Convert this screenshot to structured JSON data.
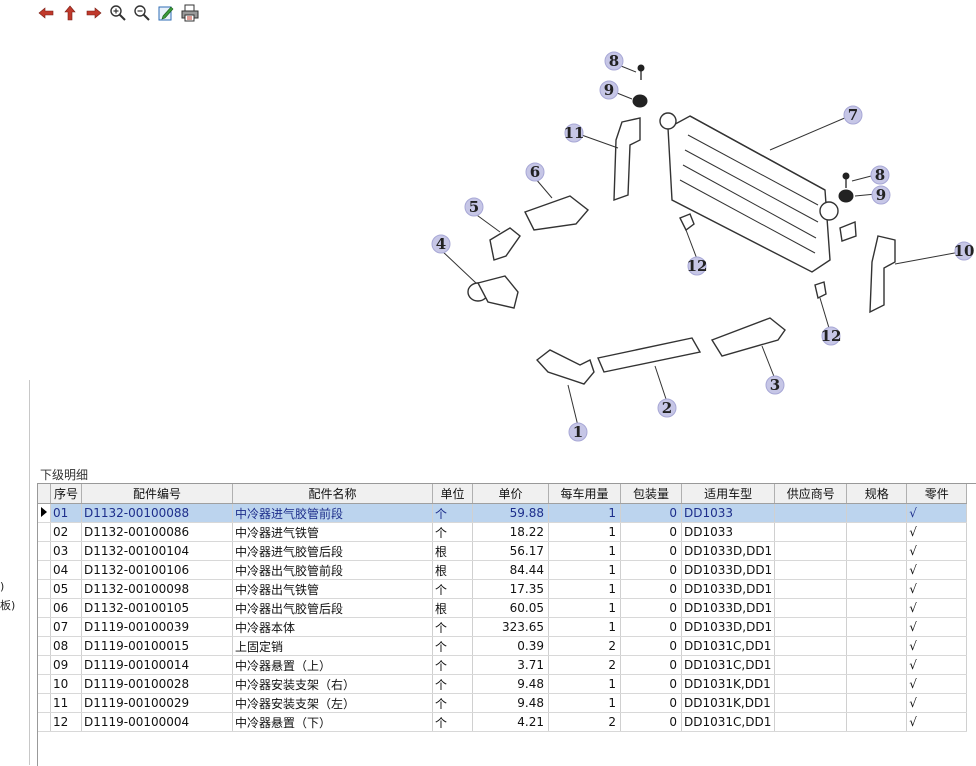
{
  "left_panel": {
    "text_1": ")",
    "text_2": "板)"
  },
  "toolbar": {
    "buttons": [
      {
        "icon": "back-arrow-icon"
      },
      {
        "icon": "up-arrow-icon"
      },
      {
        "icon": "forward-arrow-icon"
      },
      {
        "icon": "zoom-in-icon"
      },
      {
        "icon": "zoom-out-icon"
      },
      {
        "icon": "edit-icon"
      },
      {
        "icon": "print-icon"
      }
    ]
  },
  "diagram": {
    "callouts": [
      "1",
      "2",
      "3",
      "4",
      "5",
      "6",
      "7",
      "8",
      "8",
      "9",
      "9",
      "10",
      "11",
      "12",
      "12"
    ]
  },
  "section": {
    "label": "下级明细"
  },
  "table": {
    "columns": [
      "序号",
      "配件编号",
      "配件名称",
      "单位",
      "单价",
      "每车用量",
      "包装量",
      "适用车型",
      "供应商号",
      "规格",
      "零件"
    ],
    "rows": [
      [
        "01",
        "D1132-00100088",
        "中冷器进气胶管前段",
        "个",
        "59.88",
        "1",
        "0",
        "DD1033",
        "",
        "",
        "√"
      ],
      [
        "02",
        "D1132-00100086",
        "中冷器进气铁管",
        "个",
        "18.22",
        "1",
        "0",
        "DD1033",
        "",
        "",
        "√"
      ],
      [
        "03",
        "D1132-00100104",
        "中冷器进气胶管后段",
        "根",
        "56.17",
        "1",
        "0",
        "DD1033D,DD1",
        "",
        "",
        "√"
      ],
      [
        "04",
        "D1132-00100106",
        "中冷器出气胶管前段",
        "根",
        "84.44",
        "1",
        "0",
        "DD1033D,DD1",
        "",
        "",
        "√"
      ],
      [
        "05",
        "D1132-00100098",
        "中冷器出气铁管",
        "个",
        "17.35",
        "1",
        "0",
        "DD1033D,DD1",
        "",
        "",
        "√"
      ],
      [
        "06",
        "D1132-00100105",
        "中冷器出气胶管后段",
        "根",
        "60.05",
        "1",
        "0",
        "DD1033D,DD1",
        "",
        "",
        "√"
      ],
      [
        "07",
        "D1119-00100039",
        "中冷器本体",
        "个",
        "323.65",
        "1",
        "0",
        "DD1033D,DD1",
        "",
        "",
        "√"
      ],
      [
        "08",
        "D1119-00100015",
        "上固定销",
        "个",
        "0.39",
        "2",
        "0",
        "DD1031C,DD1",
        "",
        "",
        "√"
      ],
      [
        "09",
        "D1119-00100014",
        "中冷器悬置（上）",
        "个",
        "3.71",
        "2",
        "0",
        "DD1031C,DD1",
        "",
        "",
        "√"
      ],
      [
        "10",
        "D1119-00100028",
        "中冷器安装支架（右）",
        "个",
        "9.48",
        "1",
        "0",
        "DD1031K,DD1",
        "",
        "",
        "√"
      ],
      [
        "11",
        "D1119-00100029",
        "中冷器安装支架（左）",
        "个",
        "9.48",
        "1",
        "0",
        "DD1031K,DD1",
        "",
        "",
        "√"
      ],
      [
        "12",
        "D1119-00100004",
        "中冷器悬置（下）",
        "个",
        "4.21",
        "2",
        "0",
        "DD1031C,DD1",
        "",
        "",
        "√"
      ]
    ],
    "selected_row": 0
  }
}
